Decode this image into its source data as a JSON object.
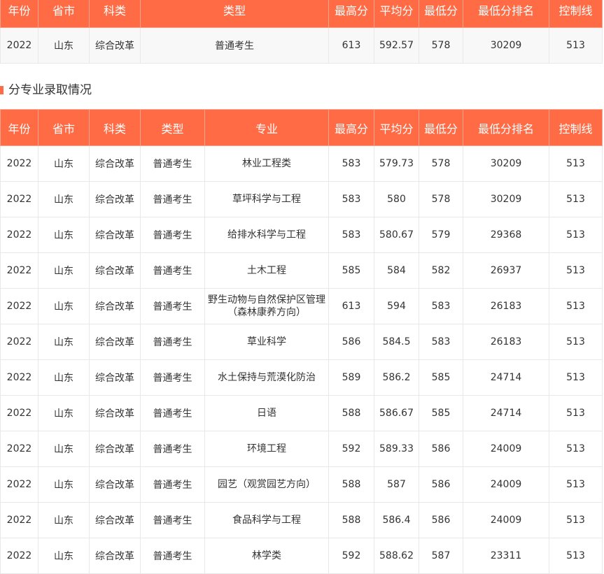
{
  "colors": {
    "accent": "#ff6b45"
  },
  "summary": {
    "headers": [
      "年份",
      "省市",
      "科类",
      "类型",
      "最高分",
      "平均分",
      "最低分",
      "最低分排名",
      "控制线"
    ],
    "rows": [
      [
        "2022",
        "山东",
        "综合改革",
        "普通考生",
        "613",
        "592.57",
        "578",
        "30209",
        "513"
      ]
    ]
  },
  "section_title": "分专业录取情况",
  "majors": {
    "headers": [
      "年份",
      "省市",
      "科类",
      "类型",
      "专业",
      "最高分",
      "平均分",
      "最低分",
      "最低分排名",
      "控制线"
    ],
    "rows": [
      [
        "2022",
        "山东",
        "综合改革",
        "普通考生",
        "林业工程类",
        "583",
        "579.73",
        "578",
        "30209",
        "513"
      ],
      [
        "2022",
        "山东",
        "综合改革",
        "普通考生",
        "草坪科学与工程",
        "583",
        "580",
        "578",
        "30209",
        "513"
      ],
      [
        "2022",
        "山东",
        "综合改革",
        "普通考生",
        "给排水科学与工程",
        "583",
        "580.67",
        "579",
        "29368",
        "513"
      ],
      [
        "2022",
        "山东",
        "综合改革",
        "普通考生",
        "土木工程",
        "585",
        "584",
        "582",
        "26937",
        "513"
      ],
      [
        "2022",
        "山东",
        "综合改革",
        "普通考生",
        "野生动物与自然保护区管理（森林康养方向）",
        "613",
        "594",
        "583",
        "26183",
        "513"
      ],
      [
        "2022",
        "山东",
        "综合改革",
        "普通考生",
        "草业科学",
        "586",
        "584.5",
        "583",
        "26183",
        "513"
      ],
      [
        "2022",
        "山东",
        "综合改革",
        "普通考生",
        "水土保持与荒漠化防治",
        "589",
        "586.2",
        "585",
        "24714",
        "513"
      ],
      [
        "2022",
        "山东",
        "综合改革",
        "普通考生",
        "日语",
        "588",
        "586.67",
        "585",
        "24714",
        "513"
      ],
      [
        "2022",
        "山东",
        "综合改革",
        "普通考生",
        "环境工程",
        "592",
        "589.33",
        "586",
        "24009",
        "513"
      ],
      [
        "2022",
        "山东",
        "综合改革",
        "普通考生",
        "园艺（观赏园艺方向）",
        "588",
        "587",
        "586",
        "24009",
        "513"
      ],
      [
        "2022",
        "山东",
        "综合改革",
        "普通考生",
        "食品科学与工程",
        "588",
        "586.4",
        "586",
        "24009",
        "513"
      ],
      [
        "2022",
        "山东",
        "综合改革",
        "普通考生",
        "林学类",
        "592",
        "588.62",
        "587",
        "23311",
        "513"
      ]
    ]
  }
}
